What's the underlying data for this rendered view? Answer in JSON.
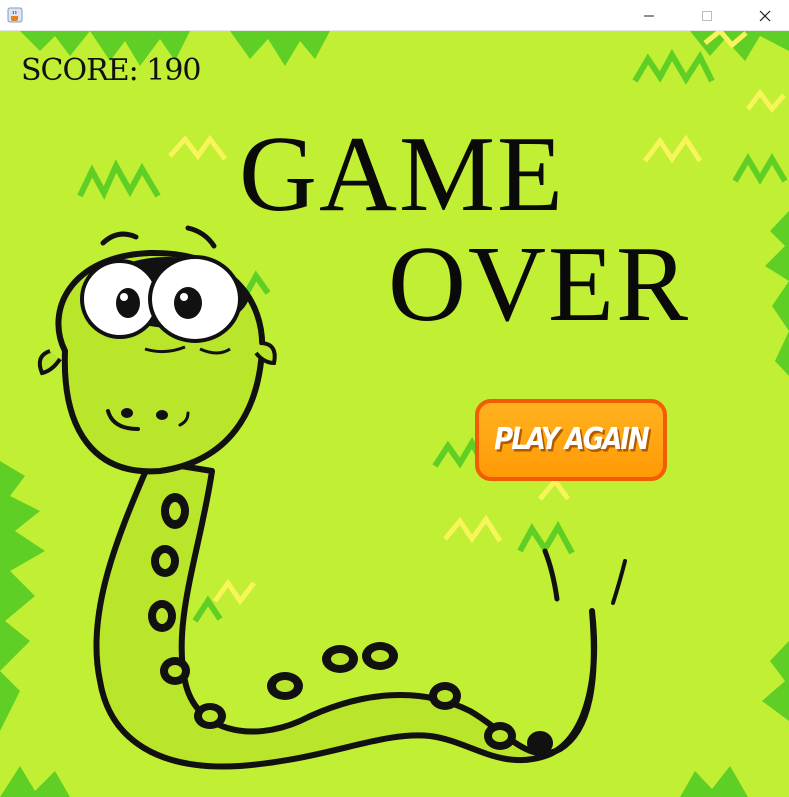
{
  "window": {
    "app_icon": "java-coffee-icon",
    "controls": {
      "minimize_icon": "minimize-icon",
      "maximize_icon": "maximize-icon",
      "close_icon": "close-icon"
    }
  },
  "game": {
    "score_text": "SCORE: 190",
    "title_line1": "GAME",
    "title_line2": "OVER",
    "play_again_label": "PLAY AGAIN",
    "colors": {
      "background": "#c1ef33",
      "foliage": "#5fcf25",
      "zigzag_yellow": "#f7f55a",
      "snake_body": "#b9e52a",
      "snake_spots": "#111111",
      "button_fill": "#ff9f0a",
      "button_border": "#f25c05"
    }
  }
}
